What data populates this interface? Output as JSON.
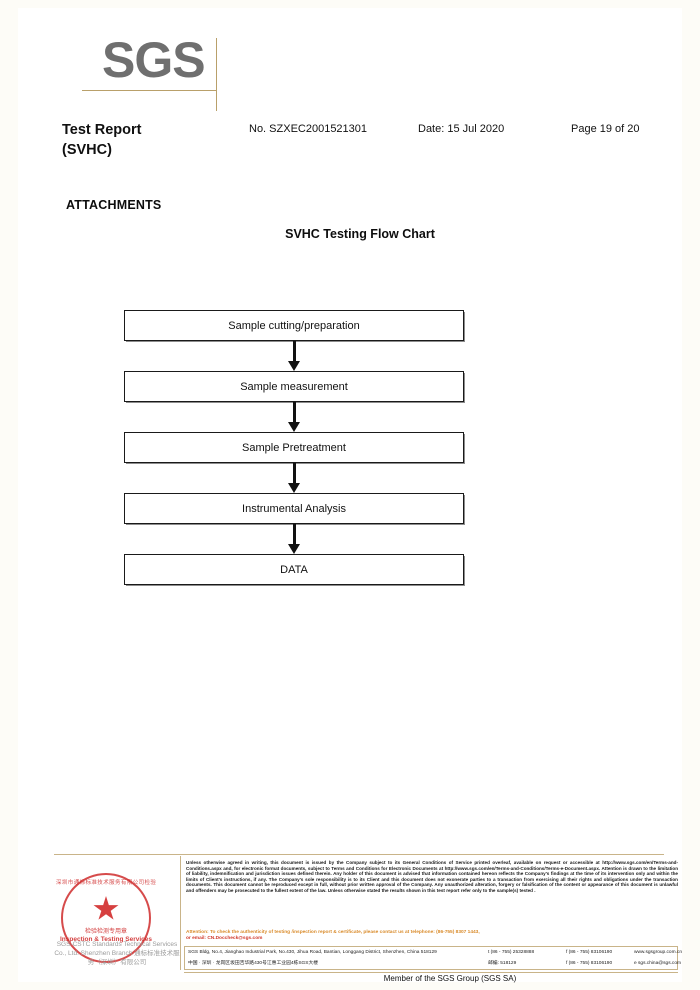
{
  "logo": {
    "text": "SGS"
  },
  "header": {
    "title_line1": "Test Report",
    "title_line2": "(SVHC)",
    "report_no": "No. SZXEC2001521301",
    "date": "Date: 15 Jul 2020",
    "page": "Page 19 of 20"
  },
  "attachments": {
    "heading": "ATTACHMENTS",
    "flow_title": "SVHC Testing Flow Chart"
  },
  "chart_data": {
    "type": "diagram",
    "title": "SVHC Testing Flow Chart",
    "orientation": "vertical",
    "steps": [
      {
        "label": "Sample cutting/preparation"
      },
      {
        "label": "Sample measurement"
      },
      {
        "label": "Sample Pretreatment"
      },
      {
        "label": "Instrumental Analysis"
      },
      {
        "label": "DATA"
      }
    ],
    "connectors": "down-arrow"
  },
  "footer": {
    "stamp": {
      "arc_text": "深圳市通标标准技术服务有限公司检验检测专用章",
      "cn_line": "检验检测专用章",
      "en_line": "Inspection & Testing Services"
    },
    "company_gray": "SGS-CSTC Standards Technical Services Co., Ltd. Shenzhen Branch 通标标准技术服务（深圳）有限公司",
    "disclaimer": "Unless otherwise agreed in writing, this document is issued by the Company subject to its General Conditions of Service printed overleaf, available on request or accessible at http://www.sgs.com/en/Terms-and-Conditions.aspx and, for electronic format documents, subject to Terms and Conditions for Electronic Documents at http://www.sgs.com/en/Terms-and-Conditions/Terms-e-Document.aspx. Attention is drawn to the limitation of liability, indemnification and jurisdiction issues defined therein. Any holder of this document is advised that information contained hereon reflects the Company's findings at the time of its intervention only and within the limits of Client's instructions, if any. The Company's sole responsibility is to its Client and this document does not exonerate parties to a transaction from exercising all their rights and obligations under the transaction documents. This document cannot be reproduced except in full, without prior written approval of the Company. Any unauthorized alteration, forgery or falsification of the content or appearance of this document is unlawful and offenders may be prosecuted to the fullest extent of the law. Unless otherwise stated the results shown in this test report refer only to the sample(s) tested .",
    "attention_line1": "Attention: To check the authenticity of testing /inspection report & certificate, please contact us at telephone: (86-755) 8307 1443,",
    "attention_line2": "or email: CN.Doccheck@sgs.com",
    "address": {
      "en": "SGS Bldg, No.4, Jianghao Industrial Park, No.430, Jihua Road, Bantian, Longgang District, Shenzhen, China 518129",
      "cn": "中国 · 深圳 · 龙岗区坂田吉华路430号江惠工业园4栋SGS大楼",
      "zip_label_en": "t (86 - 755) 25328888",
      "zip_label_cn": "邮编: 518129",
      "phone_cn": "t (86 - 755) 25328888",
      "fax_en": "f (86 - 755) 83106190",
      "fax_cn": "f (86 - 755) 83106190",
      "web": "www.sgsgroup.com.cn",
      "email": "e sgs.china@sgs.com"
    },
    "member_line": "Member of the SGS Group (SGS SA)"
  }
}
